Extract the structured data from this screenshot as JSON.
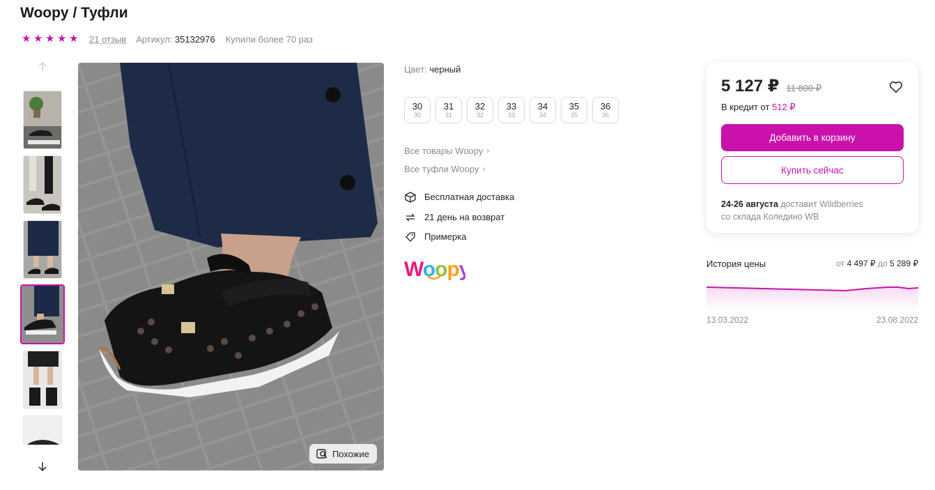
{
  "product": {
    "title": "Woopy / Туфли",
    "rating_stars": 5,
    "reviews": "21 отзыв",
    "article_label": "Артикул:",
    "article": "35132976",
    "bought": "Купили более 70 раз"
  },
  "gallery": {
    "thumb_count_visible": 6,
    "active_index": 3,
    "similar_label": "Похожие"
  },
  "details": {
    "color_label": "Цвет:",
    "color_value": "черный",
    "sizes": [
      {
        "size": "30",
        "ru": "30"
      },
      {
        "size": "31",
        "ru": "31"
      },
      {
        "size": "32",
        "ru": "32"
      },
      {
        "size": "33",
        "ru": "33"
      },
      {
        "size": "34",
        "ru": "34"
      },
      {
        "size": "35",
        "ru": "35"
      },
      {
        "size": "36",
        "ru": "36"
      }
    ],
    "links": [
      "Все товары Woopy",
      "Все туфли Woopy"
    ],
    "features": [
      {
        "icon": "box-icon",
        "label": "Бесплатная доставка"
      },
      {
        "icon": "return-icon",
        "label": "21 день на возврат"
      },
      {
        "icon": "tag-icon",
        "label": "Примерка"
      }
    ],
    "brand_logo": "Woopy"
  },
  "purchase": {
    "price": "5 127 ₽",
    "old_price": "11 800 ₽",
    "credit_label": "В кредит от",
    "credit_amount": "512 ₽",
    "cart_button": "Добавить в корзину",
    "buy_button": "Купить сейчас",
    "delivery_dates": "24-26 августа",
    "delivery_by": "доставит Wildberries",
    "delivery_from": "со склада Коледино WB"
  },
  "price_history": {
    "title": "История цены",
    "from_label": "от",
    "from_value": "4 497 ₽",
    "to_label": "до",
    "to_value": "5 289 ₽",
    "date_start": "13.03.2022",
    "date_end": "23.08.2022"
  },
  "colors": {
    "accent": "#cb11ab",
    "text": "#242424",
    "muted": "#8b8b8b"
  }
}
